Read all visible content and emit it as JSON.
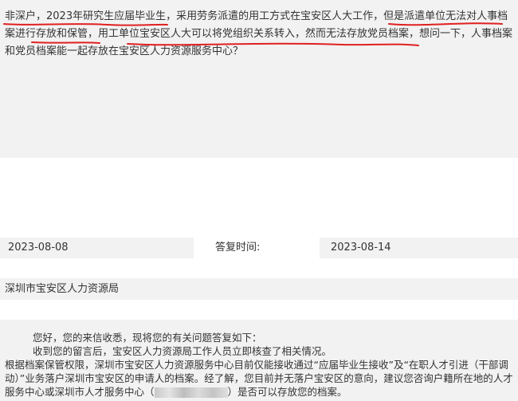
{
  "question": {
    "text": "非深户，2023年研究生应届毕业生，采用劳务派遣的用工方式在宝安区人大工作，但是派遣单位无法对人事档案进行存放和保管，用工单位宝安区人大可以将党组织关系转入，然而无法存放党员档案，想问一下，人事档案和党员档案能一起存放在宝安区人力资源服务中心？"
  },
  "meta": {
    "submit_date": "2023-08-08",
    "reply_label": "答复时间:",
    "reply_date": "2023-08-14",
    "department": "深圳市宝安区人力资源局"
  },
  "answer": {
    "line1": "您好，您的来信收悉，现将您的有关问题答复如下：",
    "line2": "收到您的留言后，宝安区人力资源局工作人员立即核查了相关情况。",
    "line3_a": "根据档案保管权限，深圳市宝安区人力资源服务中心目前仅能接收通过“应届毕业生接收”及“在职人才引进（干部调动）”业务落户深圳市宝安区的申请人的档案。经了解，您目前并无落户宝安区的意向，建议您咨询户籍所在地的人才服务中心或深圳市人才服务中心（",
    "line3_b": "）是否可以存放您的档案。"
  }
}
